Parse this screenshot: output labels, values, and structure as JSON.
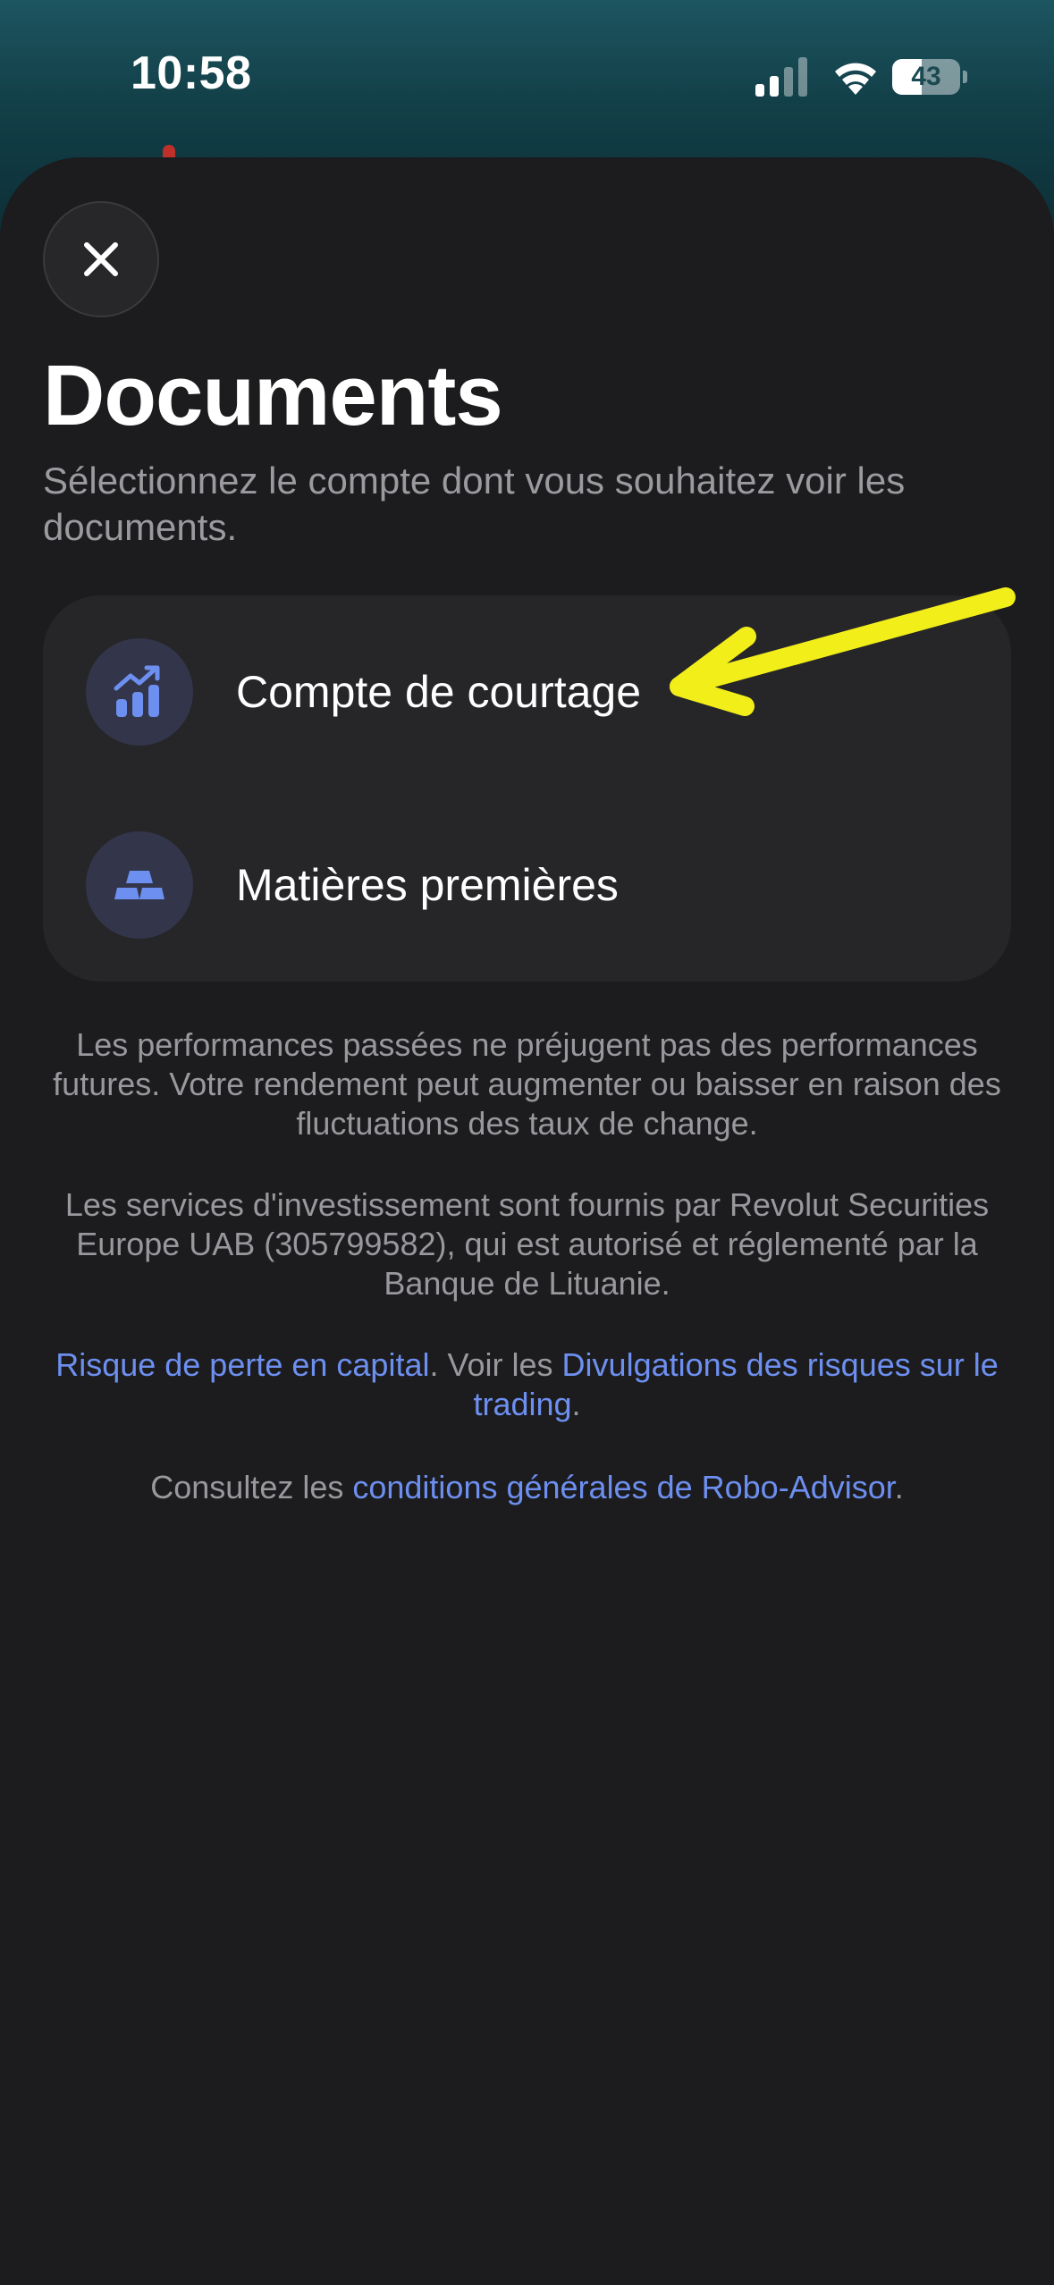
{
  "status_bar": {
    "time": "10:58",
    "battery": "43",
    "battery_level": 0.43,
    "icons": [
      "cellular-signal-icon",
      "wifi-icon",
      "battery-icon"
    ]
  },
  "sheet": {
    "title": "Documents",
    "subtitle": "Sélectionnez le compte dont vous souhaitez voir les documents.",
    "close_icon": "close-icon",
    "accounts": [
      {
        "label": "Compte de courtage",
        "icon": "trending-chart-icon"
      },
      {
        "label": "Matières premières",
        "icon": "gold-bars-icon"
      }
    ]
  },
  "footer": {
    "disclaimer": "Les performances passées ne préjugent pas des performances futures. Votre rendement peut augmenter ou baisser en raison des fluctuations des taux de change.",
    "services": "Les services d'investissement sont fournis par Revolut Securities Europe UAB (305799582), qui est autorisé et réglementé par la Banque de Lituanie.",
    "risk_link": "Risque de perte en capital",
    "risk_middle": ". Voir les ",
    "risk_disclosure_link": "Divulgations des risques sur le trading",
    "risk_end": ".",
    "terms_prefix": "Consultez les ",
    "terms_link": "conditions générales de Robo-Advisor",
    "terms_end": "."
  },
  "colors": {
    "background": "#1c1c1e",
    "card": "#262629",
    "accent_blue": "#6d8ff0",
    "annotation_yellow": "#f2ee1a"
  }
}
